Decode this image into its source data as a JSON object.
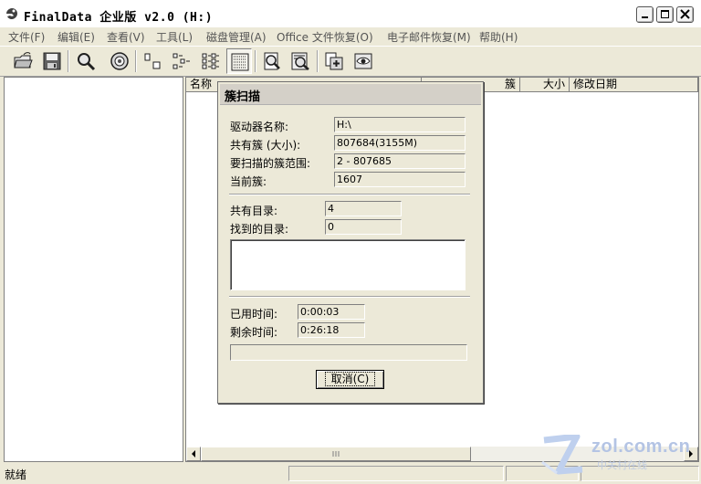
{
  "window": {
    "title": "FinalData 企业版 v2.0 (H:)"
  },
  "menu": {
    "items": [
      "文件(F)",
      "编辑(E)",
      "查看(V)",
      "工具(L)",
      "磁盘管理(A)",
      "Office 文件恢复(O)",
      "电子邮件恢复(M)",
      "帮助(H)"
    ]
  },
  "toolbar": {
    "buttons": [
      "open-folder-icon",
      "save-disk-icon",
      "search-magnifier-icon",
      "drive-icon",
      "large-icons-view-icon",
      "small-icons-view-icon",
      "list-view-icon",
      "details-view-icon",
      "find-file-icon",
      "find-cluster-icon",
      "recover-icon",
      "preview-icon"
    ]
  },
  "list": {
    "columns": [
      "名称",
      "簇",
      "大小",
      "修改日期"
    ]
  },
  "status": {
    "text": "就绪"
  },
  "dialog": {
    "title": "簇扫描",
    "drive_label": "驱动器名称:",
    "drive_value": "H:\\",
    "total_clusters_label": "共有簇 (大小):",
    "total_clusters_value": "807684(3155M)",
    "scan_range_label": "要扫描的簇范围:",
    "scan_range_value": "2 - 807685",
    "current_cluster_label": "当前簇:",
    "current_cluster_value": "1607",
    "total_dirs_label": "共有目录:",
    "total_dirs_value": "4",
    "found_dirs_label": "找到的目录:",
    "found_dirs_value": "0",
    "elapsed_label": "已用时间:",
    "elapsed_value": "0:00:03",
    "remaining_label": "剩余时间:",
    "remaining_value": "0:26:18",
    "progress_fraction": 0.0,
    "cancel_label": "取消(C)"
  },
  "watermark": {
    "text": "zol.com.cn",
    "sub": "中关村在线"
  }
}
